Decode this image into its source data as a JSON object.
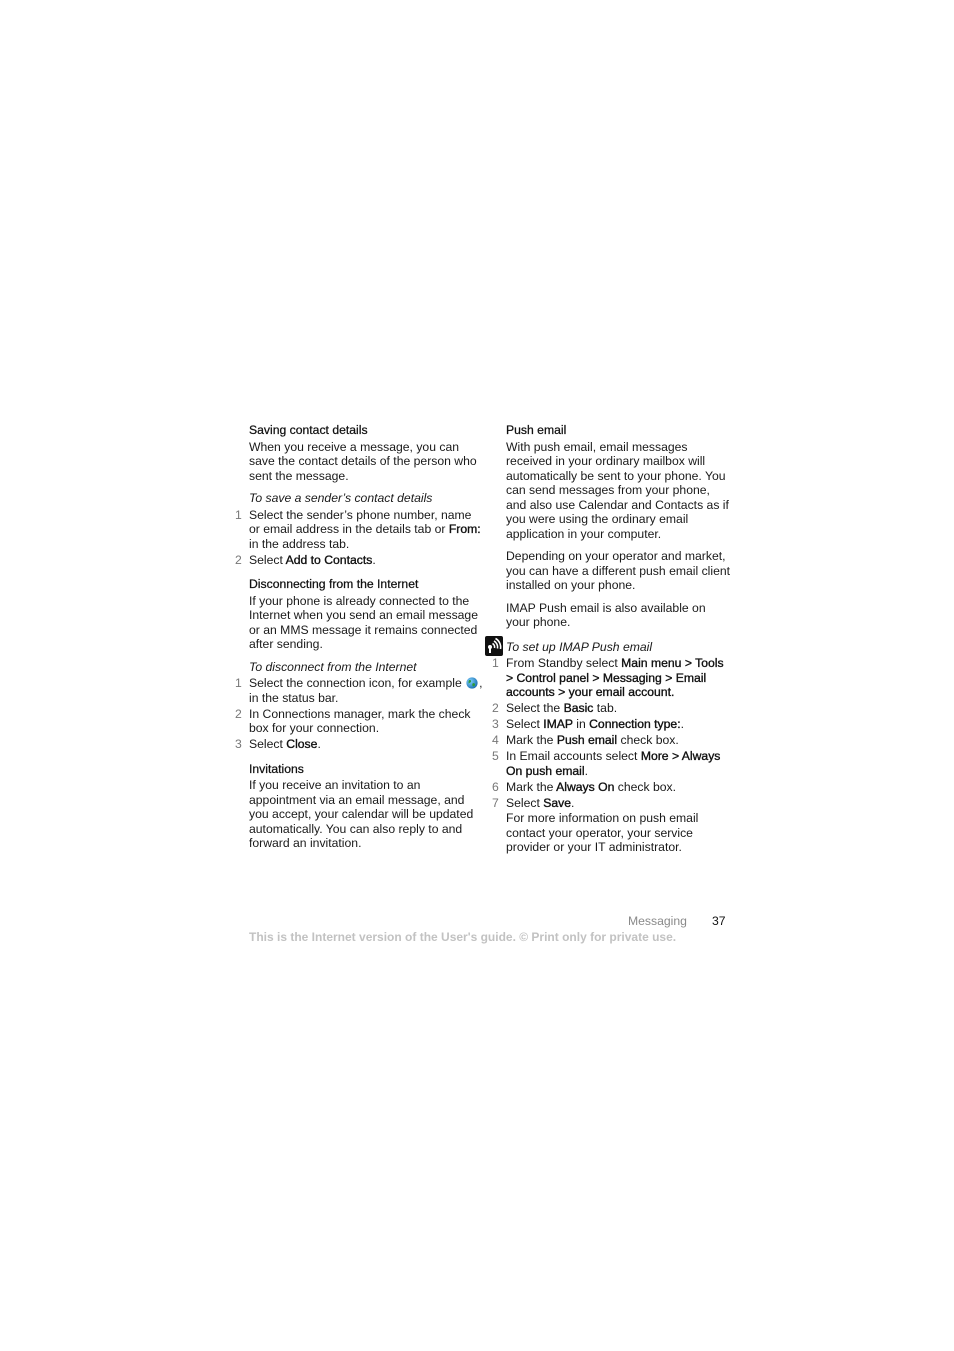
{
  "left_column": {
    "saving": {
      "heading": "Saving contact details",
      "body": "When you receive a message, you can save the contact details of the person who sent the message.",
      "task_title": "To save a sender’s contact details",
      "steps": [
        {
          "num": "1",
          "pre": "Select the sender’s phone number, name or email address in the details tab or ",
          "bold": "From:",
          "post": " in the address tab."
        },
        {
          "num": "2",
          "pre": "Select ",
          "bold": "Add to Contacts",
          "post": "."
        }
      ]
    },
    "disconnecting": {
      "heading": "Disconnecting from the Internet",
      "body": "If your phone is already connected to the Internet when you send an email message or an MMS message it remains connected after sending.",
      "task_title": "To disconnect from the Internet",
      "steps": [
        {
          "num": "1",
          "pre": "Select the connection icon, for example ",
          "icon": "globe-icon",
          "post": ", in the status bar."
        },
        {
          "num": "2",
          "text": "In Connections manager, mark the check box for your connection."
        },
        {
          "num": "3",
          "pre": "Select ",
          "bold": "Close",
          "post": "."
        }
      ]
    },
    "invitations": {
      "heading": "Invitations",
      "body": "If you receive an invitation to an appointment via an email message, and you accept, your calendar will be updated automatically. You can also reply to and forward an invitation."
    }
  },
  "right_column": {
    "push_email": {
      "heading": "Push email",
      "body1": "With push email, email messages received in your ordinary mailbox will automatically be sent to your phone. You can send messages from your phone, and also use Calendar and Contacts as if you were using the ordinary email application in your computer.",
      "body2": "Depending on your operator and market, you can have a different push email client installed on your phone.",
      "body3": "IMAP Push email is also available on your phone.",
      "task_icon": "operator-service-icon",
      "task_title": "To set up IMAP Push email",
      "steps": [
        {
          "num": "1",
          "pre": "From Standby select ",
          "bold": "Main menu > Tools > Control panel > Messaging > Email accounts > your email account",
          "post": "."
        },
        {
          "num": "2",
          "pre": "Select the ",
          "bold": "Basic",
          "post": " tab."
        },
        {
          "num": "3",
          "pre": "Select ",
          "bold": "IMAP",
          "mid": " in ",
          "bold2": "Connection type:",
          "post": "."
        },
        {
          "num": "4",
          "pre": "Mark the ",
          "bold": "Push email",
          "post": " check box."
        },
        {
          "num": "5",
          "pre": "In Email accounts select ",
          "bold": "More > Always On push email",
          "post": "."
        },
        {
          "num": "6",
          "pre": "Mark the ",
          "bold": "Always On",
          "post": " check box."
        },
        {
          "num": "7",
          "pre": "Select ",
          "bold": "Save",
          "post": "."
        }
      ],
      "note": "For more information on push email contact your operator, your service provider or your IT administrator."
    }
  },
  "footer": {
    "section": "Messaging",
    "page_number": "37",
    "notice": "This is the Internet version of the User's guide. © Print only for private use."
  }
}
